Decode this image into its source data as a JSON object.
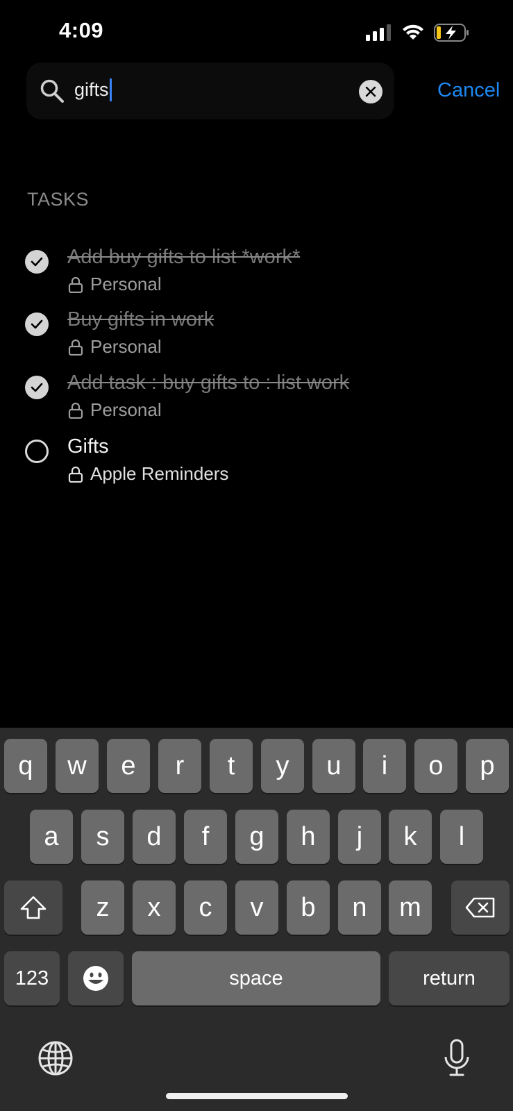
{
  "status_bar": {
    "time": "4:09"
  },
  "search": {
    "query": "gifts",
    "cancel_label": "Cancel"
  },
  "section_title": "TASKS",
  "tasks": [
    {
      "title": "Add buy gifts to list *work*",
      "list": "Personal",
      "completed": true
    },
    {
      "title": "Buy gifts  in work",
      "list": "Personal",
      "completed": true
    },
    {
      "title": "Add task : buy gifts to : list work",
      "list": "Personal",
      "completed": true
    },
    {
      "title": "Gifts",
      "list": "Apple Reminders",
      "completed": false
    }
  ],
  "keyboard": {
    "row1": [
      "q",
      "w",
      "e",
      "r",
      "t",
      "y",
      "u",
      "i",
      "o",
      "p"
    ],
    "row2": [
      "a",
      "s",
      "d",
      "f",
      "g",
      "h",
      "j",
      "k",
      "l"
    ],
    "row3": [
      "z",
      "x",
      "c",
      "v",
      "b",
      "n",
      "m"
    ],
    "numbers_label": "123",
    "space_label": "space",
    "return_label": "return"
  },
  "colors": {
    "accent": "#1e87f0",
    "caret": "#3b82f6"
  }
}
